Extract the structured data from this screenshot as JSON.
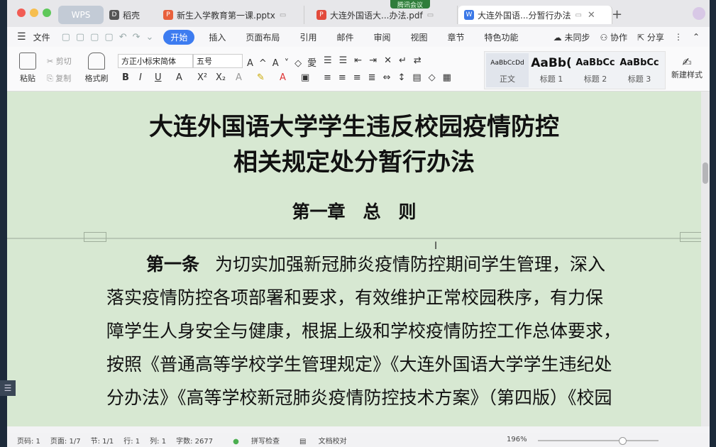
{
  "titlebar": {
    "meeting_label": "腾讯会议",
    "tabs": [
      {
        "label": "WPS"
      },
      {
        "label": "稻壳"
      },
      {
        "label": "新生入学教育第一课.pptx",
        "icon": "ppt-icon",
        "color": "#e8603c"
      },
      {
        "label": "大连外国语大...办法.pdf",
        "icon": "pdf-icon",
        "color": "#e24a3b"
      },
      {
        "label": "大连外国语...分暂行办法",
        "icon": "word-icon",
        "color": "#3b78e7"
      }
    ],
    "new_tab": "+"
  },
  "menubar": {
    "file": "文件",
    "items": [
      "开始",
      "插入",
      "页面布局",
      "引用",
      "邮件",
      "审阅",
      "视图",
      "章节",
      "特色功能"
    ],
    "active": "开始",
    "right": [
      "未同步",
      "协作",
      "分享"
    ]
  },
  "ribbon": {
    "paste": "粘贴",
    "cut": "剪切",
    "copy": "复制",
    "format_painter": "格式刷",
    "font_name": "方正小标宋简体",
    "font_size": "五号",
    "styles": [
      {
        "sample": "AaBbCcDd",
        "label": "正文"
      },
      {
        "sample": "AaBb(",
        "label": "标题 1"
      },
      {
        "sample": "AaBbCc",
        "label": "标题 2"
      },
      {
        "sample": "AaBbCc",
        "label": "标题 3"
      }
    ],
    "new_style": "新建样式"
  },
  "document": {
    "title_line1": "大连外国语大学学生违反校园疫情防控",
    "title_line2": "相关规定处分暂行办法",
    "chapter": "第一章　总　则",
    "article_label": "第一条",
    "lines": [
      "为切实加强新冠肺炎疫情防控期间学生管理，深入",
      "落实疫情防控各项部署和要求，有效维护正常校园秩序，有力保",
      "障学生人身安全与健康，根据上级和学校疫情防控工作总体要求，",
      "按照《普通高等学校学生管理规定》《大连外国语大学学生违纪处",
      "分办法》《高等学校新冠肺炎疫情防控技术方案》（第四版）《校园"
    ]
  },
  "statusbar": {
    "items": [
      "页码: 1",
      "页面: 1/7",
      "节: 1/1",
      "行: 1",
      "列: 1",
      "字数: 2677",
      "拼写检查",
      "文档校对"
    ],
    "zoom": "196%"
  },
  "colors": {
    "accent": "#3d7cf0",
    "doc_background": "#d7e8d2"
  }
}
